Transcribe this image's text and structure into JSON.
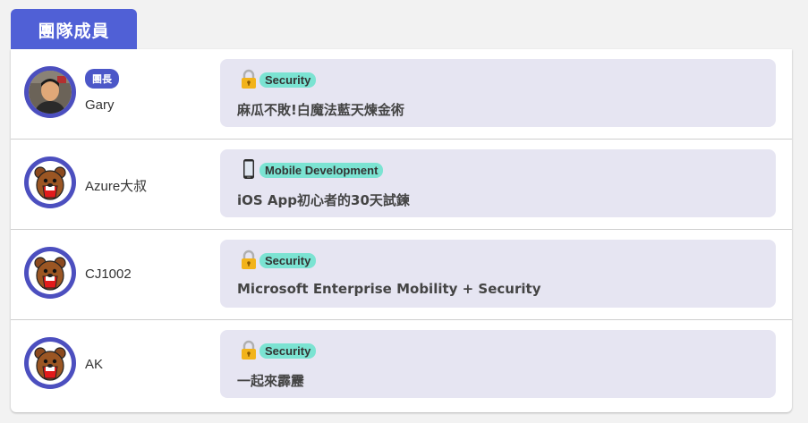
{
  "section": {
    "title": "團隊成員"
  },
  "badge": {
    "leader_label": "團長"
  },
  "members": [
    {
      "name": "Gary",
      "avatar": "photo",
      "category": "Security",
      "category_icon": "lock-icon",
      "article": "麻瓜不敗!白魔法藍天煉金術"
    },
    {
      "name": "Azure大叔",
      "avatar": "bear-icon",
      "category": "Mobile Development",
      "category_icon": "mobile-phone-icon",
      "article": "iOS App初心者的30天試鍊"
    },
    {
      "name": "CJ1002",
      "avatar": "bear-icon",
      "category": "Security",
      "category_icon": "lock-icon",
      "article": "Microsoft Enterprise Mobility + Security"
    },
    {
      "name": "AK",
      "avatar": "bear-icon",
      "category": "Security",
      "category_icon": "lock-icon",
      "article": "一起來霹靂"
    }
  ],
  "colors": {
    "tab": "#5060d6",
    "avatar_ring": "#4c4fbf",
    "card_bg": "#e6e5f2",
    "category_bg": "#7be3d2",
    "leader_badge": "#4c57c8"
  }
}
